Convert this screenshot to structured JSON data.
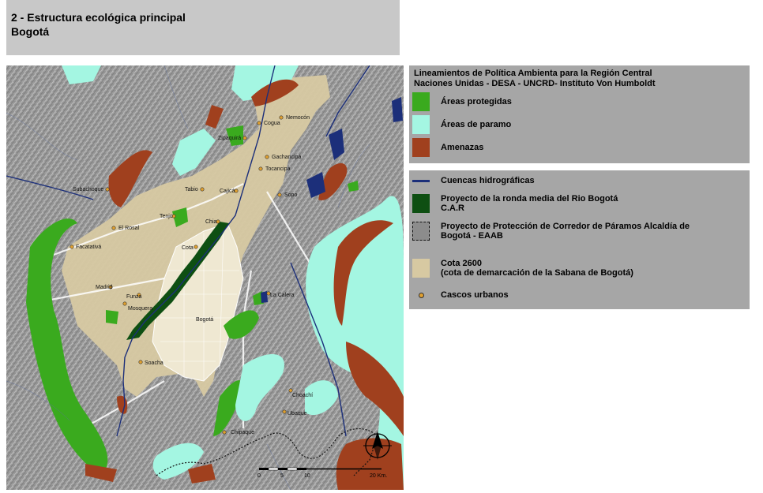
{
  "title": {
    "line1": "2 - Estructura ecológica principal",
    "line2": "Bogotá"
  },
  "legend_top": {
    "heading_line1": "Lineamientos de Política Ambienta para la Región Central",
    "heading_line2": "Naciones Unidas - DESA - UNCRD- Instituto Von Humboldt",
    "items": [
      {
        "label": "Áreas protegidas",
        "color": "#3aaa1e"
      },
      {
        "label": "Áreas de paramo",
        "color": "#a4f6e2"
      },
      {
        "label": "Amenazas",
        "color": "#a0401e"
      }
    ]
  },
  "legend_bottom": {
    "items": [
      {
        "label": "Cuencas hidrográficas",
        "color": "#1c2f7a"
      },
      {
        "label": "Proyecto de la ronda media del Rio Bogotá",
        "label2": "C.A.R",
        "color": "#0e4f12"
      },
      {
        "label": "Proyecto de Protección de Corredor de Páramos Alcaldía de",
        "label2": "Bogotá - EAAB",
        "color": "#8c8c8c"
      },
      {
        "label": "Cota 2600",
        "label2": "(cota de demarcación de la Sabana de Bogotá)",
        "color": "#d7c9a2"
      },
      {
        "label": "Cascos urbanos",
        "color": "#e0a030"
      }
    ]
  },
  "places": {
    "cogua": "Cogua",
    "nemocon": "Nemocón",
    "zipaquira": "Zipaquirá",
    "gachancipa": "Gachancipá",
    "tocancipa": "Tocancipá",
    "subachoque": "Subachoque",
    "tabio": "Tabio",
    "cajica": "Cajicá",
    "sopo": "Sopo",
    "tenjo": "Tenjo",
    "chia": "Chia",
    "el_rosal": "El Rosal",
    "facatativa": "Facatativá",
    "cota": "Cota",
    "madrid": "Madrid",
    "funza": "Funza",
    "mosquera": "Mosquera",
    "la_calera": "La Calera",
    "bogota": "Bogotá",
    "soacha": "Soacha",
    "choachi": "Choachí",
    "ubaque": "Ubaque",
    "chipaque": "Chipaque"
  },
  "scale": {
    "labels": [
      "0",
      "5",
      "10",
      "20 Km."
    ]
  },
  "north_arrow": "north-arrow"
}
